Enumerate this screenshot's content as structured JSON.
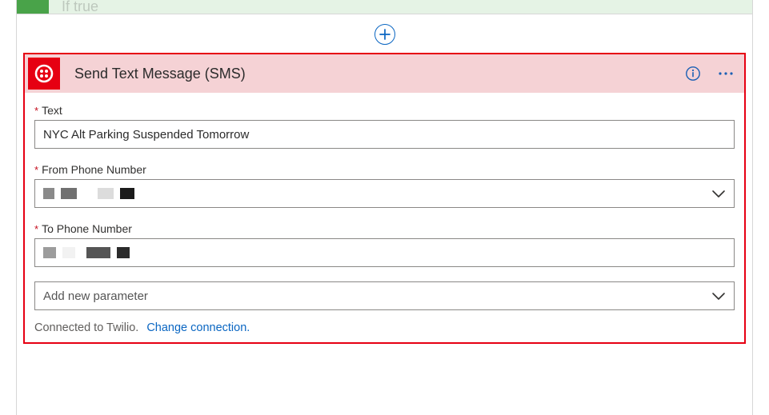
{
  "parent": {
    "label": "If true"
  },
  "card": {
    "title": "Send Text Message (SMS)",
    "fields": {
      "text": {
        "label": "Text",
        "value": "NYC Alt Parking Suspended Tomorrow"
      },
      "from": {
        "label": "From Phone Number"
      },
      "to": {
        "label": "To Phone Number"
      },
      "addParam": {
        "placeholder": "Add new parameter"
      }
    },
    "footer": {
      "status": "Connected to Twilio.",
      "link": "Change connection."
    }
  }
}
